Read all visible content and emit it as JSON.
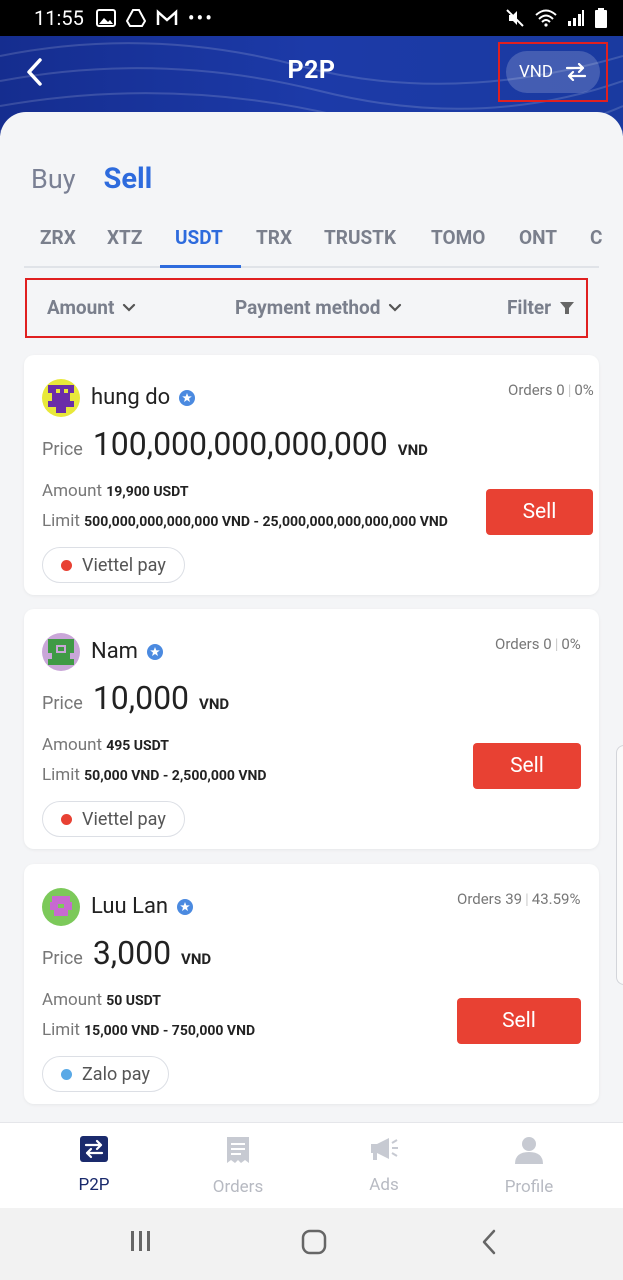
{
  "status_bar": {
    "time": "11:55"
  },
  "header": {
    "title": "P2P",
    "currency": "VND"
  },
  "mode_tabs": {
    "buy": "Buy",
    "sell": "Sell"
  },
  "coins": [
    "ZRX",
    "XTZ",
    "USDT",
    "TRX",
    "TRUSTK",
    "TOMO",
    "ONT",
    "C"
  ],
  "filters": {
    "amount": "Amount",
    "payment": "Payment method",
    "filter": "Filter"
  },
  "labels": {
    "price": "Price",
    "amount": "Amount",
    "limit": "Limit",
    "sell": "Sell",
    "orders": "Orders",
    "unit": "VND"
  },
  "offers": [
    {
      "name": "hung do",
      "orders_count": "0",
      "completion": "0%",
      "price": "100,000,000,000,000",
      "amount": "19,900 USDT",
      "limit": "500,000,000,000,000 VND - 25,000,000,000,000,000 VND",
      "payment": "Viettel pay",
      "payment_color": "#e84133"
    },
    {
      "name": "Nam",
      "orders_count": "0",
      "completion": "0%",
      "price": "10,000",
      "amount": "495 USDT",
      "limit": "50,000 VND - 2,500,000 VND",
      "payment": "Viettel pay",
      "payment_color": "#e84133"
    },
    {
      "name": "Luu Lan",
      "orders_count": "39",
      "completion": "43.59%",
      "price": "3,000",
      "amount": "50 USDT",
      "limit": "15,000 VND - 750,000 VND",
      "payment": "Zalo pay",
      "payment_color": "#5aa9e6"
    }
  ],
  "bottom_nav": {
    "p2p": "P2P",
    "orders": "Orders",
    "ads": "Ads",
    "profile": "Profile"
  }
}
